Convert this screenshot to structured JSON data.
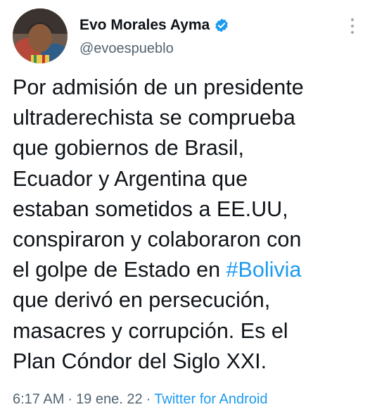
{
  "author": {
    "display_name": "Evo Morales Ayma",
    "handle": "@evoespueblo",
    "verified_icon": "verified-badge-icon"
  },
  "tweet": {
    "lines": [
      {
        "text": "Por admisión de un presidente"
      },
      {
        "text": "ultraderechista se comprueba"
      },
      {
        "text": "que gobiernos de Brasil,"
      },
      {
        "text": "Ecuador y Argentina que"
      },
      {
        "text": "estaban sometidos a EE.UU,"
      },
      {
        "text": "conspiraron y colaboraron con"
      },
      {
        "before": "el golpe de Estado en ",
        "hashtag": "#Bolivia"
      },
      {
        "text": "que derivó en persecución,"
      },
      {
        "text": "masacres y corrupción. Es el"
      },
      {
        "text": "Plan Cóndor del Siglo XXI."
      }
    ]
  },
  "meta": {
    "time": "6:17 AM",
    "separator": "·",
    "date": "19 ene. 22",
    "source": "Twitter for Android"
  },
  "colors": {
    "link": "#1d9bf0",
    "secondary": "#536471",
    "text": "#0f1419"
  }
}
